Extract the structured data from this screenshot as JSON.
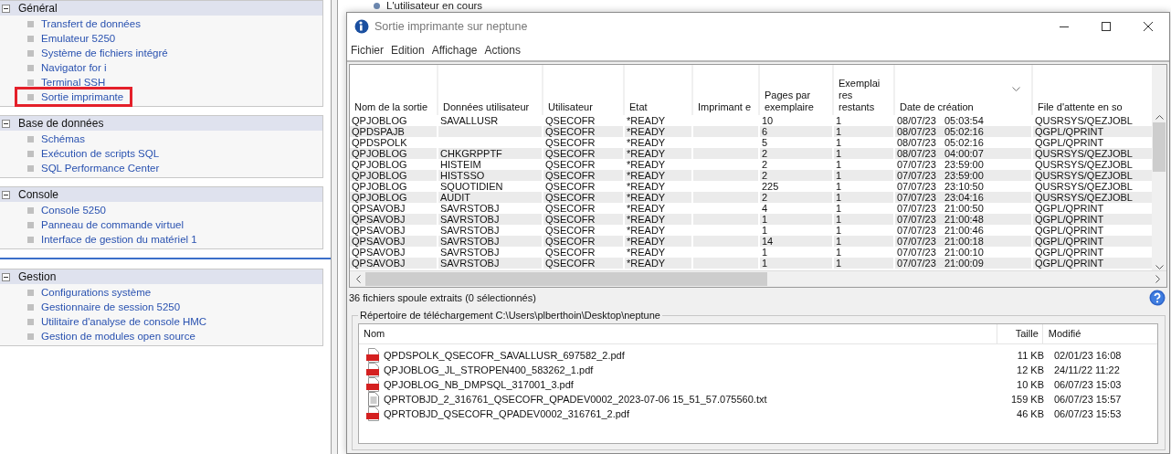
{
  "sidebar": {
    "sections": [
      {
        "title": "Général",
        "expanded": true,
        "separator_before": false,
        "items": [
          {
            "label": "Transfert de données",
            "highlighted": false
          },
          {
            "label": "Emulateur 5250",
            "highlighted": false
          },
          {
            "label": "Système de fichiers intégré",
            "highlighted": false
          },
          {
            "label": "Navigator for i",
            "highlighted": false
          },
          {
            "label": "Terminal SSH",
            "highlighted": false
          },
          {
            "label": "Sortie imprimante",
            "highlighted": true
          }
        ]
      },
      {
        "title": "Base de données",
        "expanded": true,
        "separator_before": false,
        "items": [
          {
            "label": "Schémas",
            "highlighted": false
          },
          {
            "label": "Exécution de scripts SQL",
            "highlighted": false
          },
          {
            "label": "SQL Performance Center",
            "highlighted": false
          }
        ]
      },
      {
        "title": "Console",
        "expanded": true,
        "separator_before": false,
        "items": [
          {
            "label": "Console 5250",
            "highlighted": false
          },
          {
            "label": "Panneau de commande virtuel",
            "highlighted": false
          },
          {
            "label": "Interface de gestion du matériel 1",
            "highlighted": false
          }
        ]
      },
      {
        "title": "Gestion",
        "expanded": true,
        "separator_before": true,
        "items": [
          {
            "label": "Configurations système",
            "highlighted": false
          },
          {
            "label": "Gestionnaire de session 5250",
            "highlighted": false
          },
          {
            "label": "Utilitaire d'analyse de console HMC",
            "highlighted": false
          },
          {
            "label": "Gestion de modules open source",
            "highlighted": false
          }
        ]
      }
    ]
  },
  "background_item": {
    "label": "L'utilisateur en cours"
  },
  "window": {
    "title": "Sortie imprimante sur neptune",
    "menu": [
      "Fichier",
      "Edition",
      "Affichage",
      "Actions"
    ],
    "table": {
      "columns": [
        {
          "label": "Nom de la sortie",
          "sorted": false
        },
        {
          "label": "Données utilisateur",
          "sorted": false
        },
        {
          "label": "Utilisateur",
          "sorted": false
        },
        {
          "label": "Etat",
          "sorted": false
        },
        {
          "label": "Imprimant e",
          "sorted": false
        },
        {
          "label": "Pages par exemplaire",
          "sorted": false
        },
        {
          "label": "Exemplai res restants",
          "sorted": false
        },
        {
          "label": "Date de création",
          "sorted": true
        },
        {
          "label": "File d'attente en so",
          "sorted": false
        }
      ],
      "rows": [
        [
          "QPJOBLOG",
          "SAVALLUSR",
          "QSECOFR",
          "*READY",
          "",
          "10",
          "1",
          "08/07/23   05:03:54",
          "QUSRSYS/QEZJOBL"
        ],
        [
          "QPDSPAJB",
          "",
          "QSECOFR",
          "*READY",
          "",
          "6",
          "1",
          "08/07/23   05:02:16",
          "QGPL/QPRINT"
        ],
        [
          "QPDSPOLK",
          "",
          "QSECOFR",
          "*READY",
          "",
          "5",
          "1",
          "08/07/23   05:02:16",
          "QGPL/QPRINT"
        ],
        [
          "QPJOBLOG",
          "CHKGRPPTF",
          "QSECOFR",
          "*READY",
          "",
          "2",
          "1",
          "08/07/23   04:00:07",
          "QUSRSYS/QEZJOBL"
        ],
        [
          "QPJOBLOG",
          "HISTEIM",
          "QSECOFR",
          "*READY",
          "",
          "2",
          "1",
          "07/07/23   23:59:00",
          "QUSRSYS/QEZJOBL"
        ],
        [
          "QPJOBLOG",
          "HISTSSO",
          "QSECOFR",
          "*READY",
          "",
          "2",
          "1",
          "07/07/23   23:59:00",
          "QUSRSYS/QEZJOBL"
        ],
        [
          "QPJOBLOG",
          "SQUOTIDIEN",
          "QSECOFR",
          "*READY",
          "",
          "225",
          "1",
          "07/07/23   23:10:50",
          "QUSRSYS/QEZJOBL"
        ],
        [
          "QPJOBLOG",
          "AUDIT",
          "QSECOFR",
          "*READY",
          "",
          "2",
          "1",
          "07/07/23   23:04:16",
          "QUSRSYS/QEZJOBL"
        ],
        [
          "QPSAVOBJ",
          "SAVRSTOBJ",
          "QSECOFR",
          "*READY",
          "",
          "4",
          "1",
          "07/07/23   21:00:50",
          "QGPL/QPRINT"
        ],
        [
          "QPSAVOBJ",
          "SAVRSTOBJ",
          "QSECOFR",
          "*READY",
          "",
          "1",
          "1",
          "07/07/23   21:00:48",
          "QGPL/QPRINT"
        ],
        [
          "QPSAVOBJ",
          "SAVRSTOBJ",
          "QSECOFR",
          "*READY",
          "",
          "1",
          "1",
          "07/07/23   21:00:46",
          "QGPL/QPRINT"
        ],
        [
          "QPSAVOBJ",
          "SAVRSTOBJ",
          "QSECOFR",
          "*READY",
          "",
          "14",
          "1",
          "07/07/23   21:00:18",
          "QGPL/QPRINT"
        ],
        [
          "QPSAVOBJ",
          "SAVRSTOBJ",
          "QSECOFR",
          "*READY",
          "",
          "1",
          "1",
          "07/07/23   21:00:10",
          "QGPL/QPRINT"
        ],
        [
          "QPSAVOBJ",
          "SAVRSTOBJ",
          "QSECOFR",
          "*READY",
          "",
          "1",
          "1",
          "07/07/23   21:00:09",
          "QGPL/QPRINT"
        ]
      ]
    },
    "status_text": "36 fichiers spoule extraits (0 sélectionnés)",
    "download": {
      "legend": "Répertoire de téléchargement C:\\Users\\plberthoin\\Desktop\\neptune",
      "columns": [
        "Nom",
        "Taille",
        "Modifié"
      ],
      "files": [
        {
          "kind": "pdf",
          "name": "QPDSPOLK_QSECOFR_SAVALLUSR_697582_2.pdf",
          "size": "11 KB",
          "modified": "02/01/23 16:08"
        },
        {
          "kind": "pdf",
          "name": "QPJOBLOG_JL_STROPEN400_583262_1.pdf",
          "size": "12 KB",
          "modified": "24/11/22 11:22"
        },
        {
          "kind": "pdf",
          "name": "QPJOBLOG_NB_DMPSQL_317001_3.pdf",
          "size": "10 KB",
          "modified": "06/07/23 15:03"
        },
        {
          "kind": "txt",
          "name": "QPRTOBJD_2_316761_QSECOFR_QPADEV0002_2023-07-06 15_51_57.075560.txt",
          "size": "159 KB",
          "modified": "06/07/23 15:57"
        },
        {
          "kind": "pdf",
          "name": "QPRTOBJD_QSECOFR_QPADEV0002_316761_2.pdf",
          "size": "46 KB",
          "modified": "06/07/23 15:53"
        }
      ]
    }
  }
}
